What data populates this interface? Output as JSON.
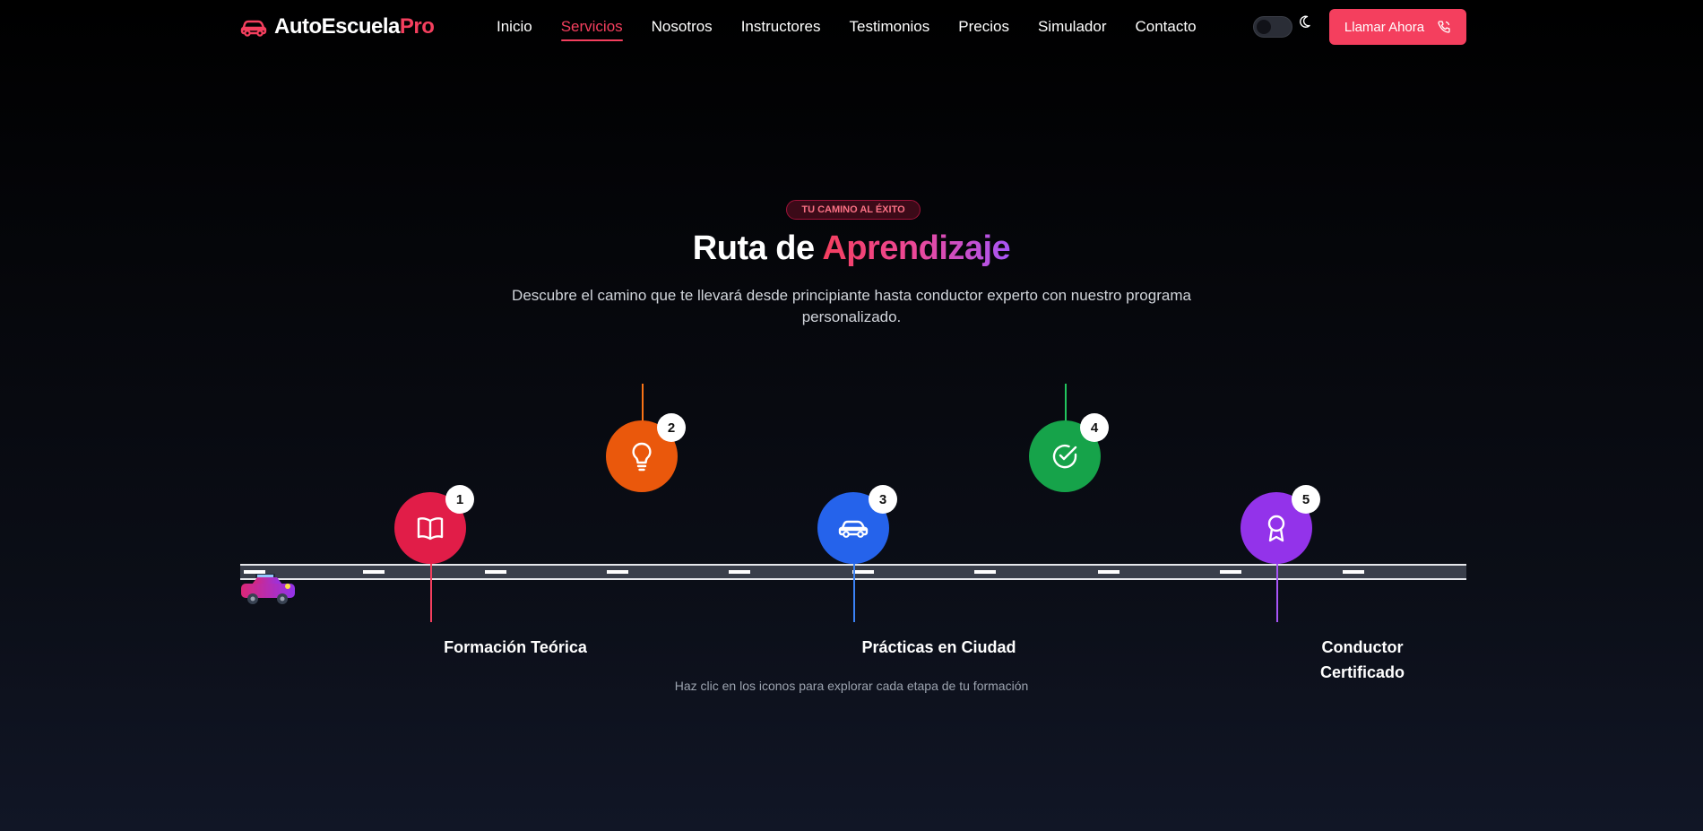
{
  "nav": {
    "logo_main": "AutoEscuela",
    "logo_accent": "Pro",
    "links": [
      {
        "label": "Inicio",
        "active": false
      },
      {
        "label": "Servicios",
        "active": true
      },
      {
        "label": "Nosotros",
        "active": false
      },
      {
        "label": "Instructores",
        "active": false
      },
      {
        "label": "Testimonios",
        "active": false
      },
      {
        "label": "Precios",
        "active": false
      },
      {
        "label": "Simulador",
        "active": false
      },
      {
        "label": "Contacto",
        "active": false
      }
    ],
    "call_label": "Llamar Ahora",
    "theme_icon": "moon-icon",
    "accent": "#f43f5e"
  },
  "hero": {
    "badge": "TU CAMINO AL ÉXITO",
    "title_plain": "Ruta de",
    "title_accent": "Aprendizaje",
    "subtitle": "Descubre el camino que te llevará desde principiante hasta conductor experto con nuestro programa personalizado.",
    "hint": "Haz clic en los iconos para explorar cada etapa de tu formación"
  },
  "steps": [
    {
      "number": "1",
      "icon": "book-icon",
      "color": "#f43f5e",
      "label": "Formación Teórica"
    },
    {
      "number": "2",
      "icon": "lightbulb-icon",
      "color": "#f97316",
      "label": ""
    },
    {
      "number": "3",
      "icon": "car-icon",
      "color": "#3b82f6",
      "label": "Prácticas en Ciudad"
    },
    {
      "number": "4",
      "icon": "check-circle-icon",
      "color": "#22c55e",
      "label": ""
    },
    {
      "number": "5",
      "icon": "award-icon",
      "color": "#a855f7",
      "label": "Conductor Certificado"
    }
  ]
}
